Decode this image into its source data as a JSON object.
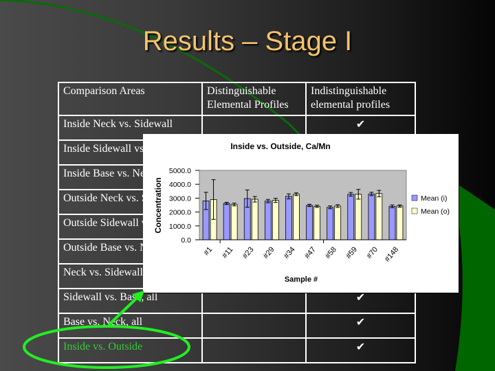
{
  "slide": {
    "title": "Results – Stage I"
  },
  "table": {
    "headers": [
      "Comparison Areas",
      "Distinguishable Elemental Profiles",
      "Indistinguishable elemental profiles"
    ],
    "header_lines": {
      "col2": [
        "Distinguishable",
        "Elemental Profiles"
      ],
      "col3": [
        "Indistinguishable",
        "elemental profiles"
      ]
    },
    "rows": [
      {
        "area": "Inside Neck vs. Sidewall",
        "distinguishable": "",
        "indistinguishable": "✔"
      },
      {
        "area": "Inside Sidewall vs. Base",
        "distinguishable": "",
        "indistinguishable": ""
      },
      {
        "area": "Inside Base vs. Neck",
        "distinguishable": "",
        "indistinguishable": ""
      },
      {
        "area": "Outside Neck vs. Sidewall",
        "distinguishable": "",
        "indistinguishable": ""
      },
      {
        "area": "Outside Sidewall vs. Base",
        "distinguishable": "",
        "indistinguishable": ""
      },
      {
        "area": "Outside Base vs. Neck",
        "distinguishable": "",
        "indistinguishable": ""
      },
      {
        "area": "Neck vs. Sidewall, all",
        "distinguishable": "",
        "indistinguishable": ""
      },
      {
        "area": "Sidewall vs. Base, all",
        "distinguishable": "",
        "indistinguishable": "✔"
      },
      {
        "area": "Base vs. Neck, all",
        "distinguishable": "",
        "indistinguishable": "✔"
      },
      {
        "area": "Inside vs. Outside",
        "distinguishable": "",
        "indistinguishable": "✔",
        "highlighted": true
      }
    ]
  },
  "colors": {
    "title": "#f5c36a",
    "highlight": "#33cc33",
    "check": "#22dd22",
    "annotation": "#22dd22",
    "series_i": "#9999ff",
    "series_o": "#ffffcc",
    "plot_bg": "#c0c0c0"
  },
  "chart_data": {
    "type": "bar",
    "title": "Inside vs. Outside, Ca/Mn",
    "xlabel": "Sample #",
    "ylabel": "Concentration",
    "ylim": [
      0,
      5000
    ],
    "yticks": [
      "0.0",
      "1000.0",
      "2000.0",
      "3000.0",
      "4000.0",
      "5000.0"
    ],
    "ytick_values": [
      0,
      1000,
      2000,
      3000,
      4000,
      5000
    ],
    "categories": [
      "#1",
      "#11",
      "#23",
      "#29",
      "#34",
      "#47",
      "#58",
      "#59",
      "#70",
      "#148"
    ],
    "series": [
      {
        "name": "Mean (i)",
        "values": [
          2800,
          2620,
          2970,
          2790,
          3130,
          2480,
          2340,
          3280,
          3300,
          2410
        ],
        "errors": [
          620,
          80,
          620,
          120,
          180,
          80,
          100,
          130,
          120,
          100
        ]
      },
      {
        "name": "Mean (o)",
        "values": [
          2900,
          2540,
          2920,
          2840,
          3280,
          2410,
          2430,
          3280,
          3330,
          2430
        ],
        "errors": [
          1430,
          100,
          200,
          150,
          100,
          80,
          100,
          350,
          230,
          80
        ]
      }
    ],
    "legend": [
      "Mean (i)",
      "Mean (o)"
    ],
    "legend_position": "right",
    "grid": false
  }
}
